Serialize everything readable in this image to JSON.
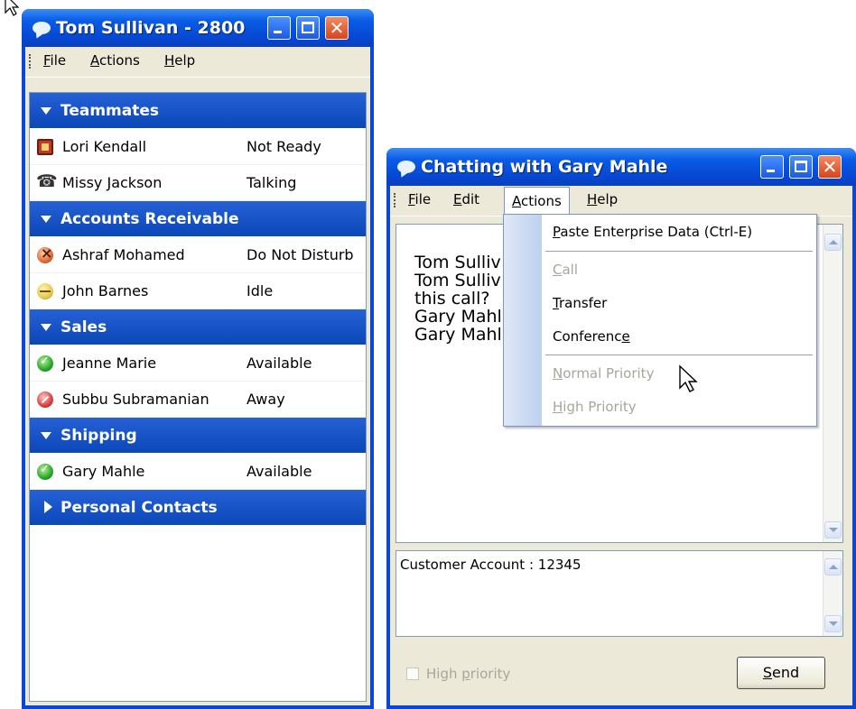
{
  "contacts_window": {
    "title": "Tom Sullivan - 2800",
    "menu": [
      {
        "label": "File",
        "key": "F",
        "rest": "ile"
      },
      {
        "label": "Actions",
        "key": "A",
        "rest": "ctions"
      },
      {
        "label": "Help",
        "key": "H",
        "rest": "elp"
      }
    ],
    "groups": [
      {
        "label": "Teammates",
        "expanded": true,
        "members": [
          {
            "name": "Lori Kendall",
            "status": "Not Ready",
            "icon": "not-ready-icon"
          },
          {
            "name": "Missy Jackson",
            "status": "Talking",
            "icon": "phone-handset-icon"
          }
        ]
      },
      {
        "label": "Accounts Receivable",
        "expanded": true,
        "members": [
          {
            "name": "Ashraf Mohamed",
            "status": "Do Not Disturb",
            "icon": "do-not-disturb-icon"
          },
          {
            "name": "John Barnes",
            "status": "Idle",
            "icon": "idle-icon"
          }
        ]
      },
      {
        "label": "Sales",
        "expanded": true,
        "members": [
          {
            "name": "Jeanne Marie",
            "status": "Available",
            "icon": "available-check-icon"
          },
          {
            "name": "Subbu Subramanian",
            "status": "Away",
            "icon": "away-icon"
          }
        ]
      },
      {
        "label": "Shipping",
        "expanded": true,
        "members": [
          {
            "name": "Gary Mahle",
            "status": "Available",
            "icon": "available-check-icon"
          }
        ]
      },
      {
        "label": "Personal Contacts",
        "expanded": false,
        "members": []
      }
    ]
  },
  "chat_window": {
    "title": "Chatting with Gary Mahle",
    "menu": [
      {
        "label": "File",
        "key": "F",
        "rest": "ile"
      },
      {
        "label": "Edit",
        "key": "E",
        "rest": "dit"
      },
      {
        "label": "Actions",
        "key": "A",
        "rest": "ctions"
      },
      {
        "label": "Help",
        "key": "H",
        "rest": "elp"
      }
    ],
    "transcript_visible": [
      "Tom Sulliv",
      "Tom Sulliv",
      "this call?",
      "Gary Mahl",
      "Gary Mahl"
    ],
    "input_value": "Customer Account : 12345",
    "high_priority_label_pre": "High ",
    "high_priority_label_key": "p",
    "high_priority_label_post": "riority",
    "high_priority_checked": false,
    "send_key": "S",
    "send_rest": "end",
    "actions_menu": [
      {
        "pre": "",
        "key": "P",
        "post": "aste Enterprise Data (Ctrl-E)",
        "disabled": false
      },
      {
        "pre": "",
        "key": "C",
        "post": "all",
        "disabled": true
      },
      {
        "pre": "",
        "key": "T",
        "post": "ransfer",
        "disabled": false
      },
      {
        "pre": "Conferenc",
        "key": "e",
        "post": "",
        "disabled": false
      },
      {
        "pre": "",
        "key": "N",
        "post": "ormal Priority",
        "disabled": true
      },
      {
        "pre": "",
        "key": "H",
        "post": "igh Priority",
        "disabled": true
      }
    ]
  }
}
